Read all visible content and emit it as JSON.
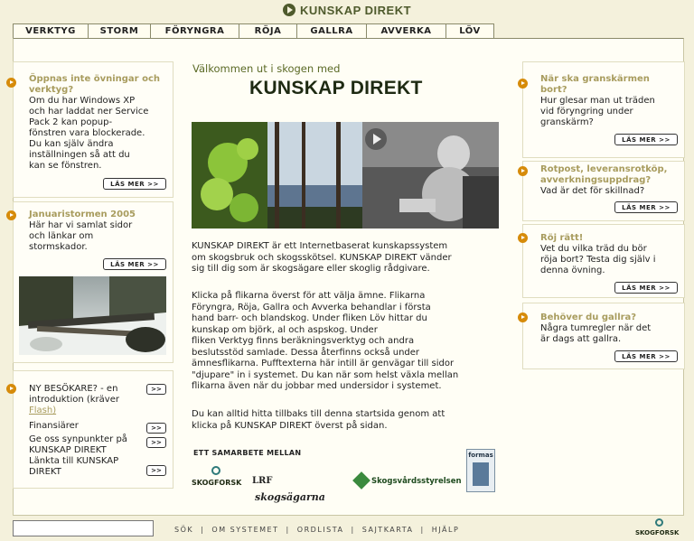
{
  "header": {
    "title": "KUNSKAP DIREKT"
  },
  "tabs": [
    "VERKTYG",
    "STORM",
    "FÖRYNGRA",
    "RÖJA",
    "GALLRA",
    "AVVERKA",
    "LÖV"
  ],
  "left": {
    "box1": {
      "title_l1": "Öppnas inte övningar och",
      "title_l2": "verktyg?",
      "body_l1": "Om du har Windows XP",
      "body_l2": "och har laddat ner Service",
      "body_l3": "Pack 2 kan popup-",
      "body_l4": "fönstren vara blockerade.",
      "body_l5": "Du kan själv ändra",
      "body_l6": "inställningen så att du",
      "body_l7": "kan se fönstren.",
      "more": "LÄS MER >>"
    },
    "box2": {
      "title": "Januaristormen 2005",
      "body_l1": "Här har vi samlat sidor",
      "body_l2": "och länkar om",
      "body_l3": "stormskador.",
      "more": "LÄS MER >>"
    },
    "box3": {
      "l1": "NY BESÖKARE? - en",
      "l2": "introduktion (kräver",
      "l3": "Flash)",
      "l4": "Finansiärer",
      "l5": "Ge oss synpunkter på",
      "l6": "KUNSKAP DIREKT",
      "l7": "Länkta till KUNSKAP",
      "l8": "DIREKT",
      "arrow": ">>"
    }
  },
  "center": {
    "welcome": "Välkommen ut i skogen med",
    "title": "KUNSKAP DIREKT",
    "p1_l1": "KUNSKAP DIREKT är ett Internetbaserat kunskapssystem",
    "p1_l2": "om skogsbruk och skogsskötsel. KUNSKAP DIREKT vänder",
    "p1_l3": "sig till dig som är skogsägare eller skoglig rådgivare.",
    "p2_l1": "Klicka på flikarna överst för att välja ämne. Flikarna",
    "p2_l2": "Föryngra, Röja, Gallra och Avverka behandlar i första",
    "p2_l3": "hand barr- och blandskog. Under fliken Löv hittar du",
    "p2_l4": "kunskap om björk, al och aspskog. Under",
    "p2_l5": "fliken Verktyg finns beräkningsverktyg och andra",
    "p2_l6": "beslutsstöd samlade. Dessa återfinns också under",
    "p2_l7": "ämnesflikarna. Pufftexterna här intill är genvägar till sidor",
    "p2_l8": "\"djupare\" in i systemet. Du kan när som helst växla mellan",
    "p2_l9": "flikarna även när du jobbar med undersidor i systemet.",
    "p3_l1": "Du kan alltid hitta tillbaks till denna startsida genom att",
    "p3_l2": "klicka på KUNSKAP DIREKT överst på sidan.",
    "partners_title": "ETT SAMARBETE MELLAN",
    "partner1": "SKOGFORSK",
    "partner2_a": "LRF",
    "partner2_b": "skogsägarna",
    "partner3": "Skogsvårdsstyrelsen",
    "partner4": "formas"
  },
  "right": {
    "box1": {
      "t1": "När ska granskärmen",
      "t2": "bort?",
      "b1": "Hur glesar man ut träden",
      "b2": "vid föryngring under",
      "b3": "granskärm?",
      "more": "LÄS MER >>"
    },
    "box2": {
      "t1": "Rotpost, leveransrotköp,",
      "t2": "avverkningsuppdrag?",
      "b1": "Vad är det för skillnad?",
      "more": "LÄS MER >>"
    },
    "box3": {
      "t1": "Röj rätt!",
      "b1": "Vet du vilka träd du bör",
      "b2": "röja bort? Testa dig själv i",
      "b3": "denna övning.",
      "more": "LÄS MER >>"
    },
    "box4": {
      "t1": "Behöver du gallra?",
      "b1": "Några tumregler när det",
      "b2": "är dags att gallra.",
      "more": "LÄS MER >>"
    }
  },
  "footer": {
    "links": [
      "SÖK",
      "OM SYSTEMET",
      "ORDLISTA",
      "SAJTKARTA",
      "HJÄLP"
    ],
    "sep": "|",
    "logo": "SKOGFORSK"
  },
  "colors": {
    "accent": "#d68b0a",
    "title_green": "#4e5a2c",
    "question": "#a89c5e",
    "background": "#f4f1dc"
  }
}
